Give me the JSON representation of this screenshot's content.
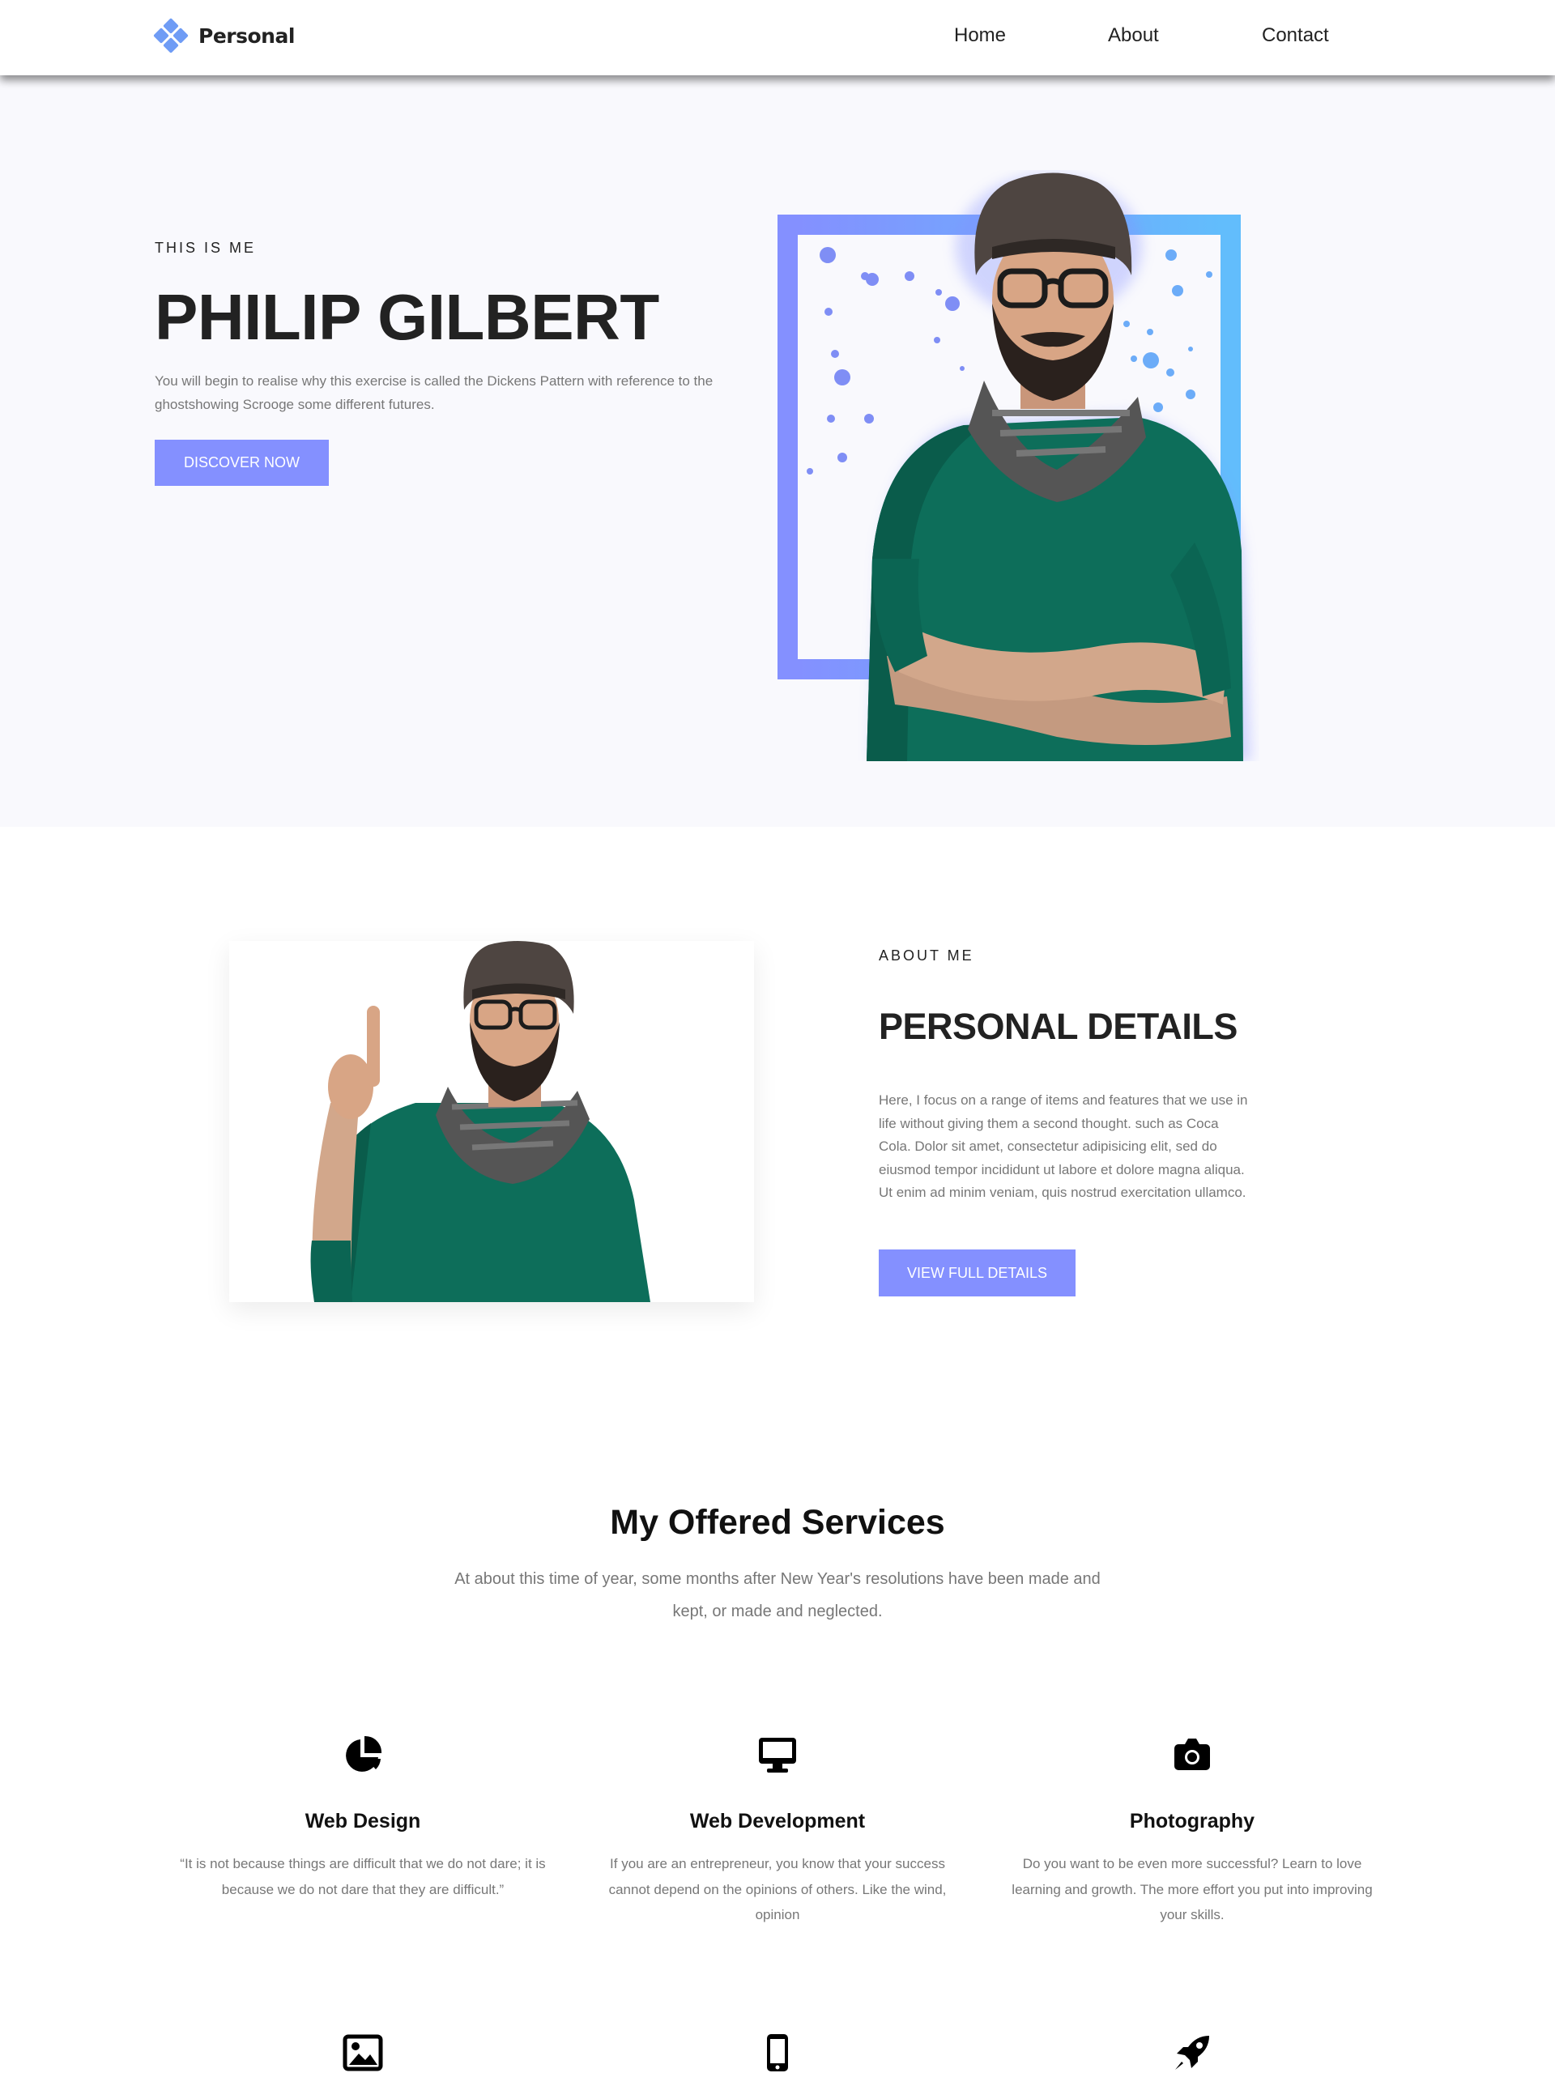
{
  "header": {
    "brand": "Personal",
    "nav": [
      {
        "label": "Home"
      },
      {
        "label": "About"
      },
      {
        "label": "Contact"
      }
    ]
  },
  "hero": {
    "eyebrow": "THIS IS ME",
    "title": "PHILIP GILBERT",
    "description": "You will begin to realise why this exercise is called the Dickens Pattern with reference to the ghostshowing Scrooge some different futures.",
    "button": "DISCOVER NOW"
  },
  "about": {
    "eyebrow": "ABOUT ME",
    "title": "PERSONAL DETAILS",
    "description": "Here, I focus on a range of items and features that we use in life without giving them a second thought. such as Coca Cola. Dolor sit amet, consectetur adipisicing elit, sed do eiusmod tempor incididunt ut labore et dolore magna aliqua. Ut enim ad minim veniam, quis nostrud exercitation ullamco.",
    "button": "VIEW FULL DETAILS"
  },
  "services": {
    "title": "My Offered Services",
    "subtitle": "At about this time of year, some months after New Year's resolutions have been made and kept, or made and neglected.",
    "items": [
      {
        "icon": "pie-chart-icon",
        "title": "Web Design",
        "description": "“It is not because things are difficult that we do not dare; it is because we do not dare that they are difficult.”"
      },
      {
        "icon": "desktop-icon",
        "title": "Web Development",
        "description": "If you are an entrepreneur, you know that your success cannot depend on the opinions of others. Like the wind, opinion"
      },
      {
        "icon": "camera-icon",
        "title": "Photography",
        "description": "Do you want to be even more successful? Learn to love learning and growth. The more effort you put into improving your skills."
      }
    ],
    "next_row_icons": [
      "image-icon",
      "mobile-icon",
      "rocket-icon"
    ]
  },
  "colors": {
    "accent": "#8490ff",
    "accent_gradient_end": "#62bdfc",
    "logo": "#6f9cf5",
    "hero_bg": "#f9f9fd",
    "text_dark": "#222222",
    "text_muted": "#777777"
  }
}
